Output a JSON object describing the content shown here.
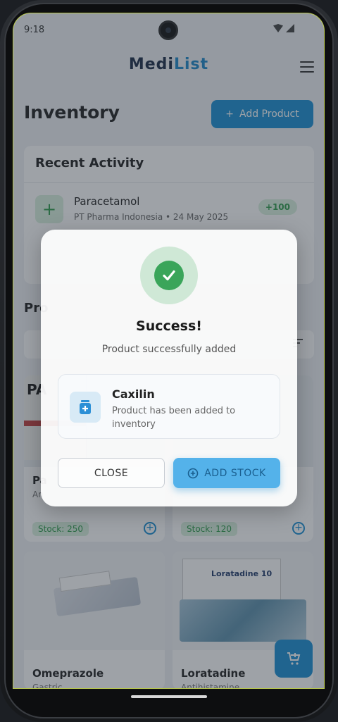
{
  "status": {
    "time": "9:18"
  },
  "app": {
    "logo_part1": "Medi",
    "logo_part2": "List"
  },
  "page": {
    "title": "Inventory",
    "add_product_label": "Add Product"
  },
  "recent_activity": {
    "title": "Recent Activity",
    "items": [
      {
        "name": "Paracetamol",
        "meta": "PT Pharma Indonesia • 24 May 2025",
        "badge": "+100"
      }
    ]
  },
  "products_section": {
    "label_partial": "Pro"
  },
  "products": [
    {
      "name": "Pa",
      "category": "An",
      "stock": "Stock: 250",
      "pack_text": "PA"
    },
    {
      "name": "",
      "category": "",
      "stock": "Stock: 120"
    },
    {
      "name": "Omeprazole",
      "category": "Gastric",
      "pack_text": ""
    },
    {
      "name": "Loratadine",
      "category": "Antihistamine",
      "pack_text": "Loratadine 10"
    }
  ],
  "modal": {
    "title": "Success!",
    "subtitle": "Product successfully added",
    "product_name": "Caxilin",
    "product_desc": "Product has been added to inventory",
    "close_label": "CLOSE",
    "add_stock_label": "ADD STOCK"
  },
  "colors": {
    "accent": "#1b8fd3",
    "success": "#3aa55a",
    "brand_dark": "#1a2b46"
  }
}
